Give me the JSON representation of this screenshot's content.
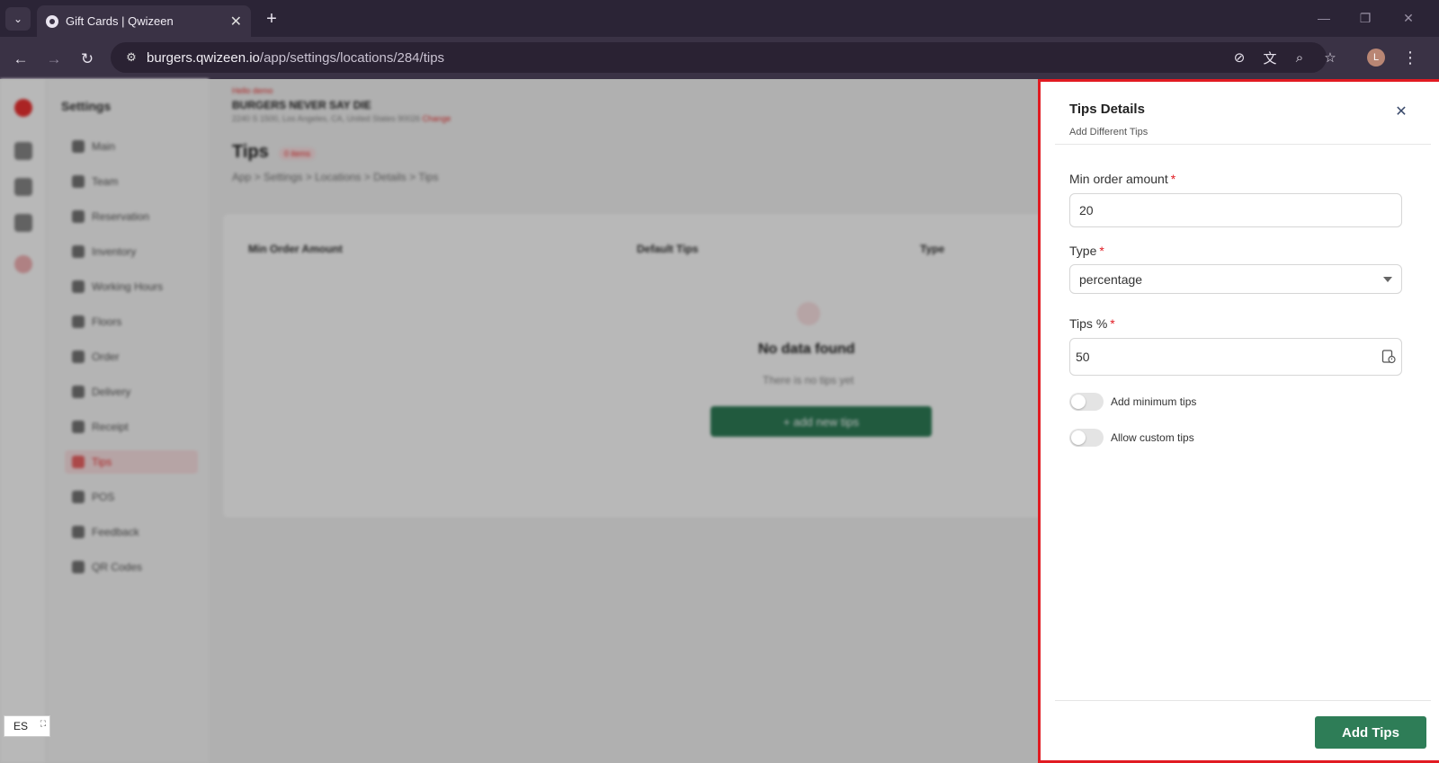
{
  "browser": {
    "tab_title": "Gift Cards | Qwizeen",
    "url_host": "burgers.qwizeen.io",
    "url_path": "/app/settings/locations/284/tips",
    "profile_initial": "L"
  },
  "background": {
    "sidebar_title": "Settings",
    "nav_items": [
      "Main",
      "Team",
      "Reservation",
      "Inventory",
      "Working Hours",
      "Floors",
      "Order",
      "Delivery",
      "Receipt",
      "Tips",
      "POS",
      "Feedback",
      "QR Codes"
    ],
    "location_label": "Hello demo",
    "location_name": "BURGERS NEVER SAY DIE",
    "location_address": "2240 S 1500, Los Angeles, CA, United States 90026",
    "change_link": "Change",
    "page_title": "Tips",
    "page_badge": "0 items",
    "breadcrumb": "App > Settings > Locations > Details > Tips",
    "columns": [
      "Min Order Amount",
      "Default Tips",
      "Type"
    ],
    "empty_title": "No data found",
    "empty_sub": "There is no tips yet",
    "add_button": "+ add new tips",
    "language": "ES"
  },
  "drawer": {
    "title": "Tips Details",
    "subtitle": "Add Different Tips",
    "fields": {
      "min_order": {
        "label": "Min order amount",
        "value": "20"
      },
      "type": {
        "label": "Type",
        "value": "percentage"
      },
      "tips_percent": {
        "label": "Tips %",
        "value": "50"
      }
    },
    "toggles": {
      "min_tips": "Add minimum tips",
      "custom_tips": "Allow custom tips"
    },
    "submit_label": "Add Tips"
  },
  "colors": {
    "accent_green": "#2e7d57",
    "required_red": "#e11b22",
    "chrome_dark": "#2b2436"
  }
}
